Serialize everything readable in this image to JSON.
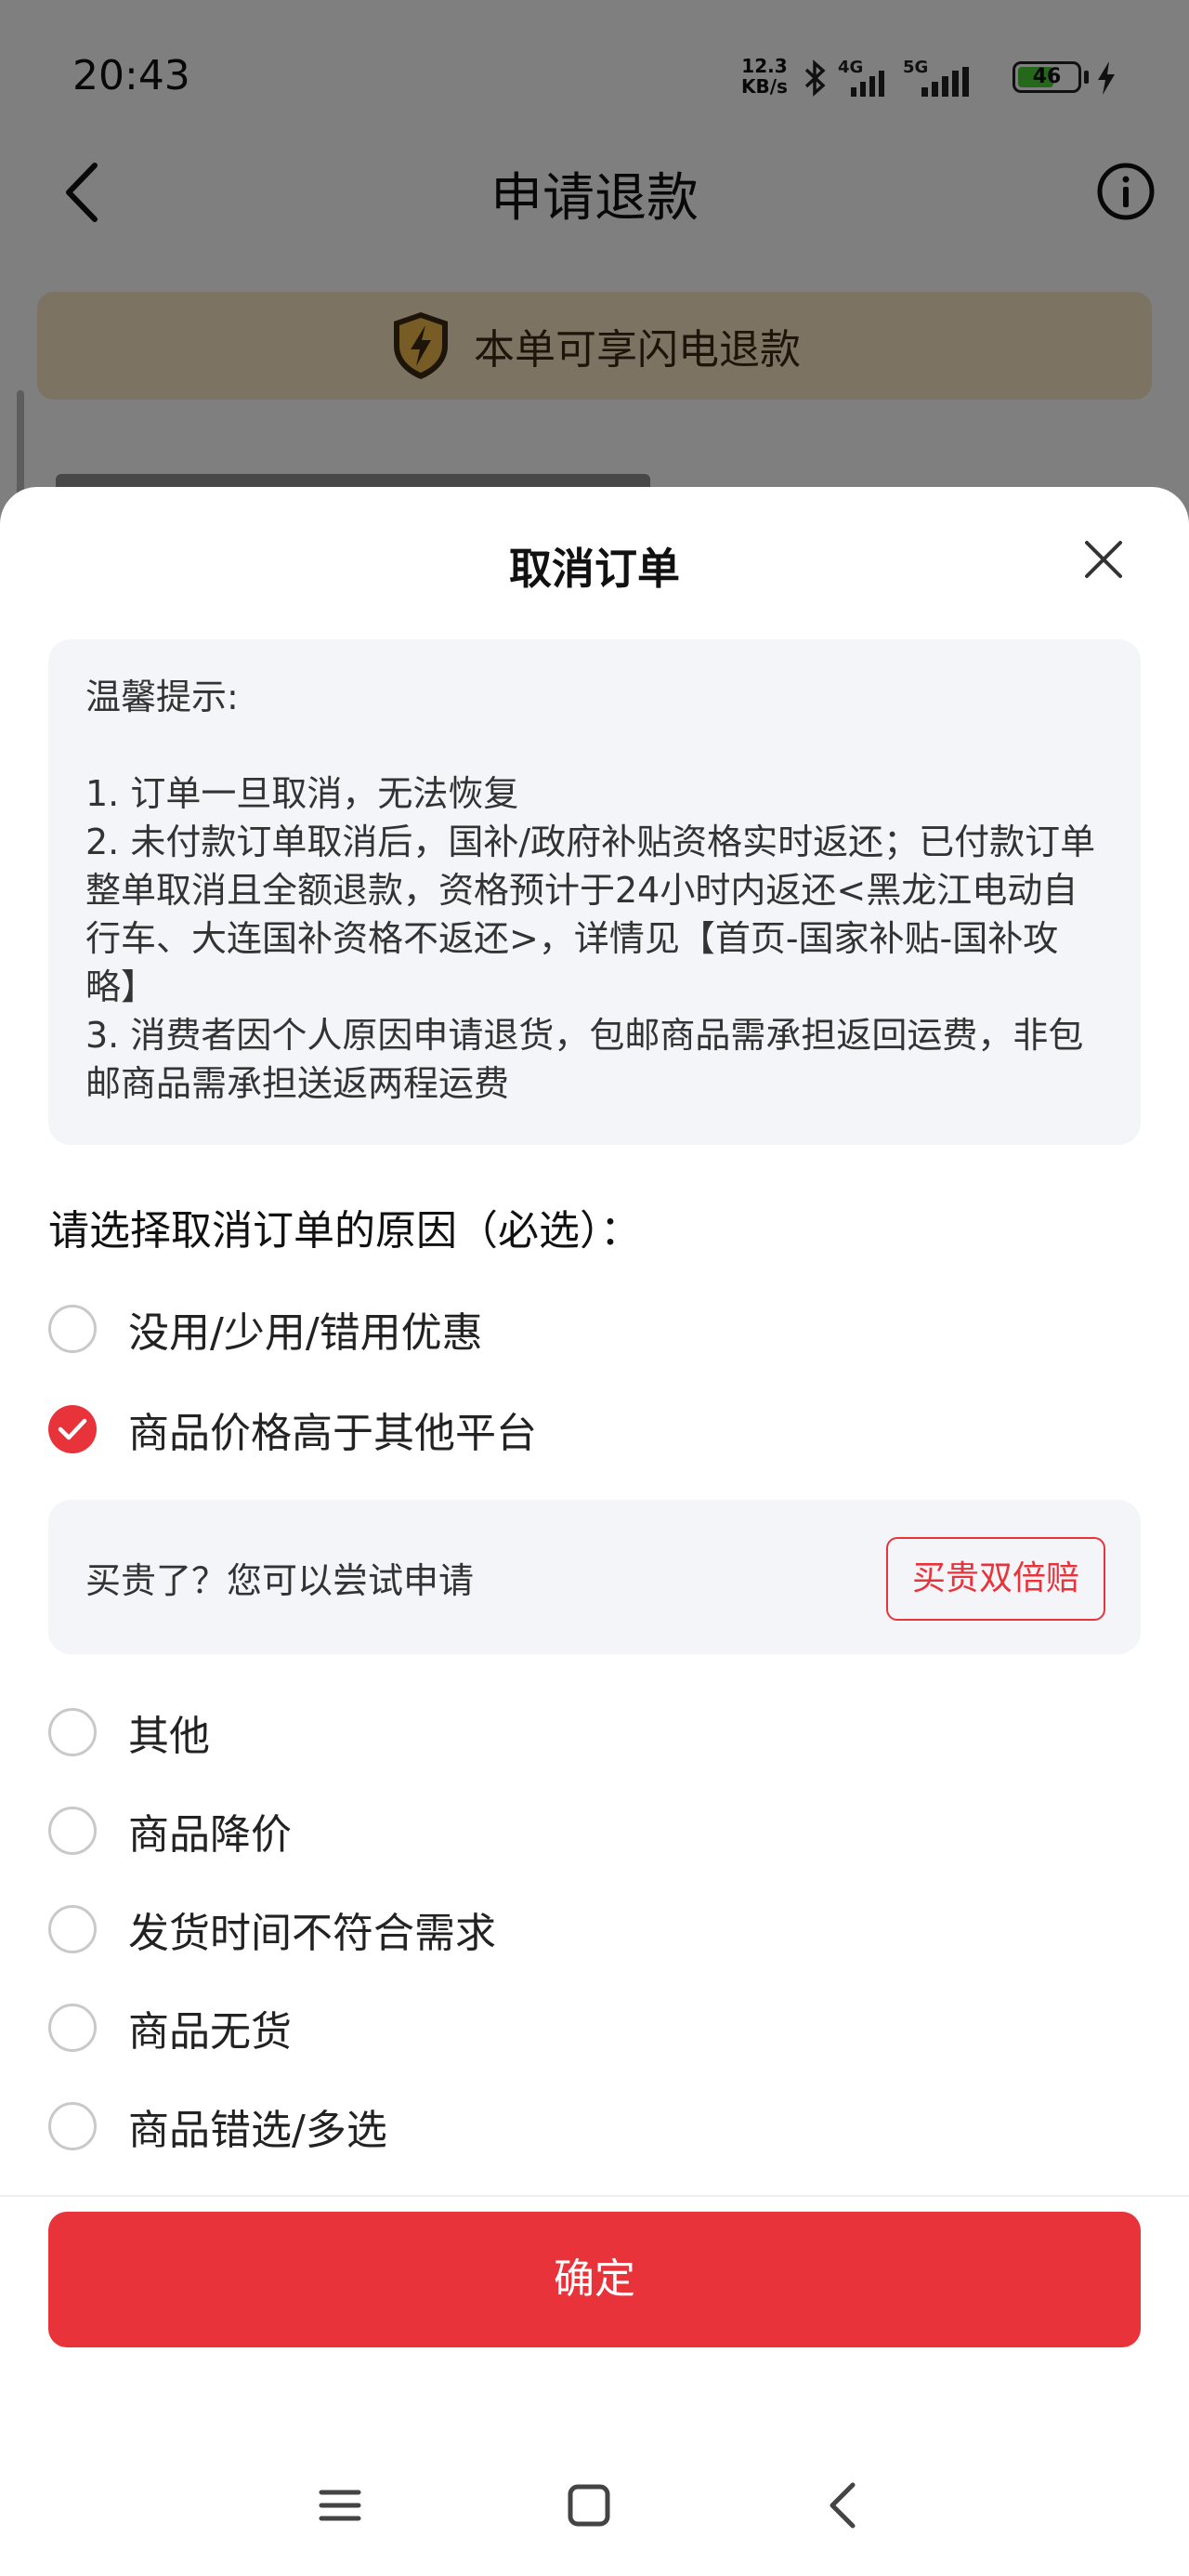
{
  "status_bar": {
    "time": "20:43",
    "speed_value": "12.3",
    "speed_unit": "KB/s",
    "net1": "4G",
    "net2": "5G",
    "battery": "46"
  },
  "header": {
    "title": "申请退款"
  },
  "banner": {
    "text": "本单可享闪电退款"
  },
  "sheet": {
    "title": "取消订单",
    "tips": {
      "heading": "温馨提示:",
      "lines": [
        "1. 订单一旦取消，无法恢复",
        "2. 未付款订单取消后，国补/政府补贴资格实时返还；已付款订单",
        "整单取消且全额退款，资格预计于24小时内返还<黑龙江电动自",
        "行车、大连国补资格不返还>，详情见【首页-国家补贴-国补攻",
        "略】",
        "3. 消费者因个人原因申请退货，包邮商品需承担返回运费，非包",
        "邮商品需承担送返两程运费"
      ]
    },
    "reason_heading": "请选择取消订单的原因（必选）：",
    "reasons": [
      {
        "label": "没用/少用/错用优惠",
        "checked": false
      },
      {
        "label": "商品价格高于其他平台",
        "checked": true
      },
      {
        "label": "其他",
        "checked": false
      },
      {
        "label": "商品降价",
        "checked": false
      },
      {
        "label": "发货时间不符合需求",
        "checked": false
      },
      {
        "label": "商品无货",
        "checked": false
      },
      {
        "label": "商品错选/多选",
        "checked": false
      }
    ],
    "promo": {
      "text": "买贵了？您可以尝试申请",
      "button": "买贵双倍赔"
    },
    "confirm": "确定"
  },
  "colors": {
    "accent": "#e8333a",
    "banner_bg": "#f8e7c5",
    "tips_bg": "#f4f5f9"
  },
  "icons": [
    "back-arrow-icon",
    "info-icon",
    "lightning-shield-icon",
    "close-icon",
    "check-icon",
    "menu-icon",
    "home-icon",
    "back-icon"
  ]
}
